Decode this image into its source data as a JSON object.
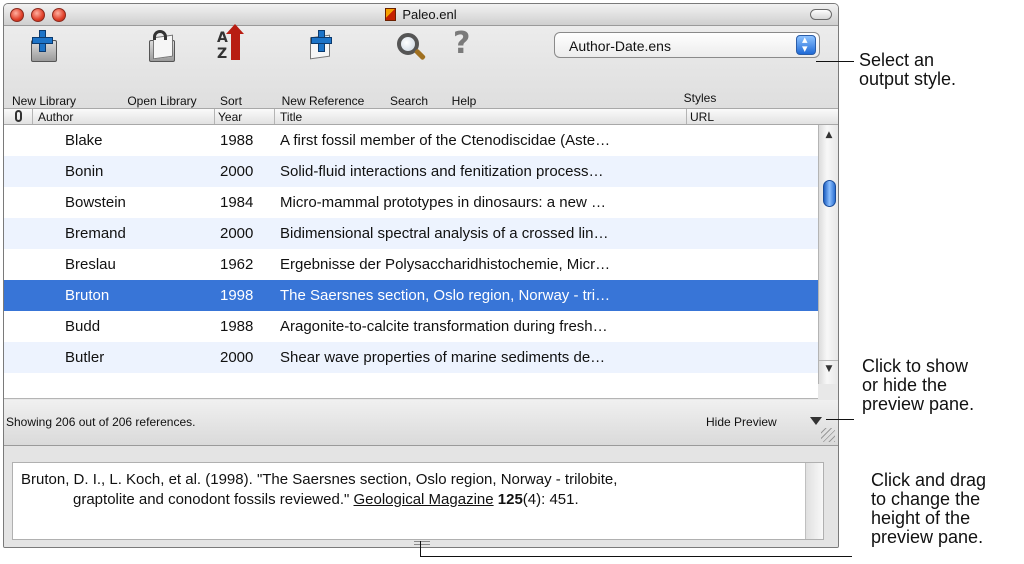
{
  "window": {
    "title": "Paleo.enl"
  },
  "toolbar": {
    "new_library": "New Library",
    "open_library": "Open Library",
    "sort": "Sort",
    "new_reference": "New Reference",
    "search": "Search",
    "help": "Help",
    "styles_label": "Styles",
    "style_value": "Author-Date.ens"
  },
  "columns": {
    "author": "Author",
    "year": "Year",
    "title": "Title",
    "url": "URL"
  },
  "rows": [
    {
      "author": "Blake",
      "year": "1988",
      "title": "A first fossil member of the Ctenodiscidae (Aste…"
    },
    {
      "author": "Bonin",
      "year": "2000",
      "title": "Solid-fluid interactions and fenitization process…"
    },
    {
      "author": "Bowstein",
      "year": "1984",
      "title": "Micro-mammal prototypes in dinosaurs: a new …"
    },
    {
      "author": "Bremand",
      "year": "2000",
      "title": "Bidimensional spectral analysis of a crossed lin…"
    },
    {
      "author": "Breslau",
      "year": "1962",
      "title": "Ergebnisse der Polysaccharidhistochemie, Micr…"
    },
    {
      "author": "Bruton",
      "year": "1998",
      "title": "The Saersnes section, Oslo region, Norway - tri…"
    },
    {
      "author": "Budd",
      "year": "1988",
      "title": "Aragonite-to-calcite transformation during fresh…"
    },
    {
      "author": "Butler",
      "year": "2000",
      "title": "Shear wave properties of marine sediments de…"
    }
  ],
  "selected_row": "Bruton",
  "status": {
    "text": "Showing 206 out of 206 references.",
    "hide_preview": "Hide Preview"
  },
  "preview": {
    "part1": "Bruton, D. I., L. Koch, et al. (1998). \"The Saersnes section, Oslo region, Norway - trilobite,",
    "part2": "graptolite and conodont fossils reviewed.\" ",
    "journal": "Geological Magazine",
    "volume": "125",
    "issue_pages": "(4): 451."
  },
  "callouts": {
    "output_style": [
      "Select an",
      "output style."
    ],
    "preview_toggle": [
      "Click to show",
      "or hide the",
      "preview pane."
    ],
    "drag": [
      "Click and drag",
      "to change the",
      "height of the",
      "preview pane."
    ]
  },
  "colors": {
    "selection": "#3875d7",
    "alt_row": "#edf3fe",
    "accent_blue": "#1d74c8"
  }
}
